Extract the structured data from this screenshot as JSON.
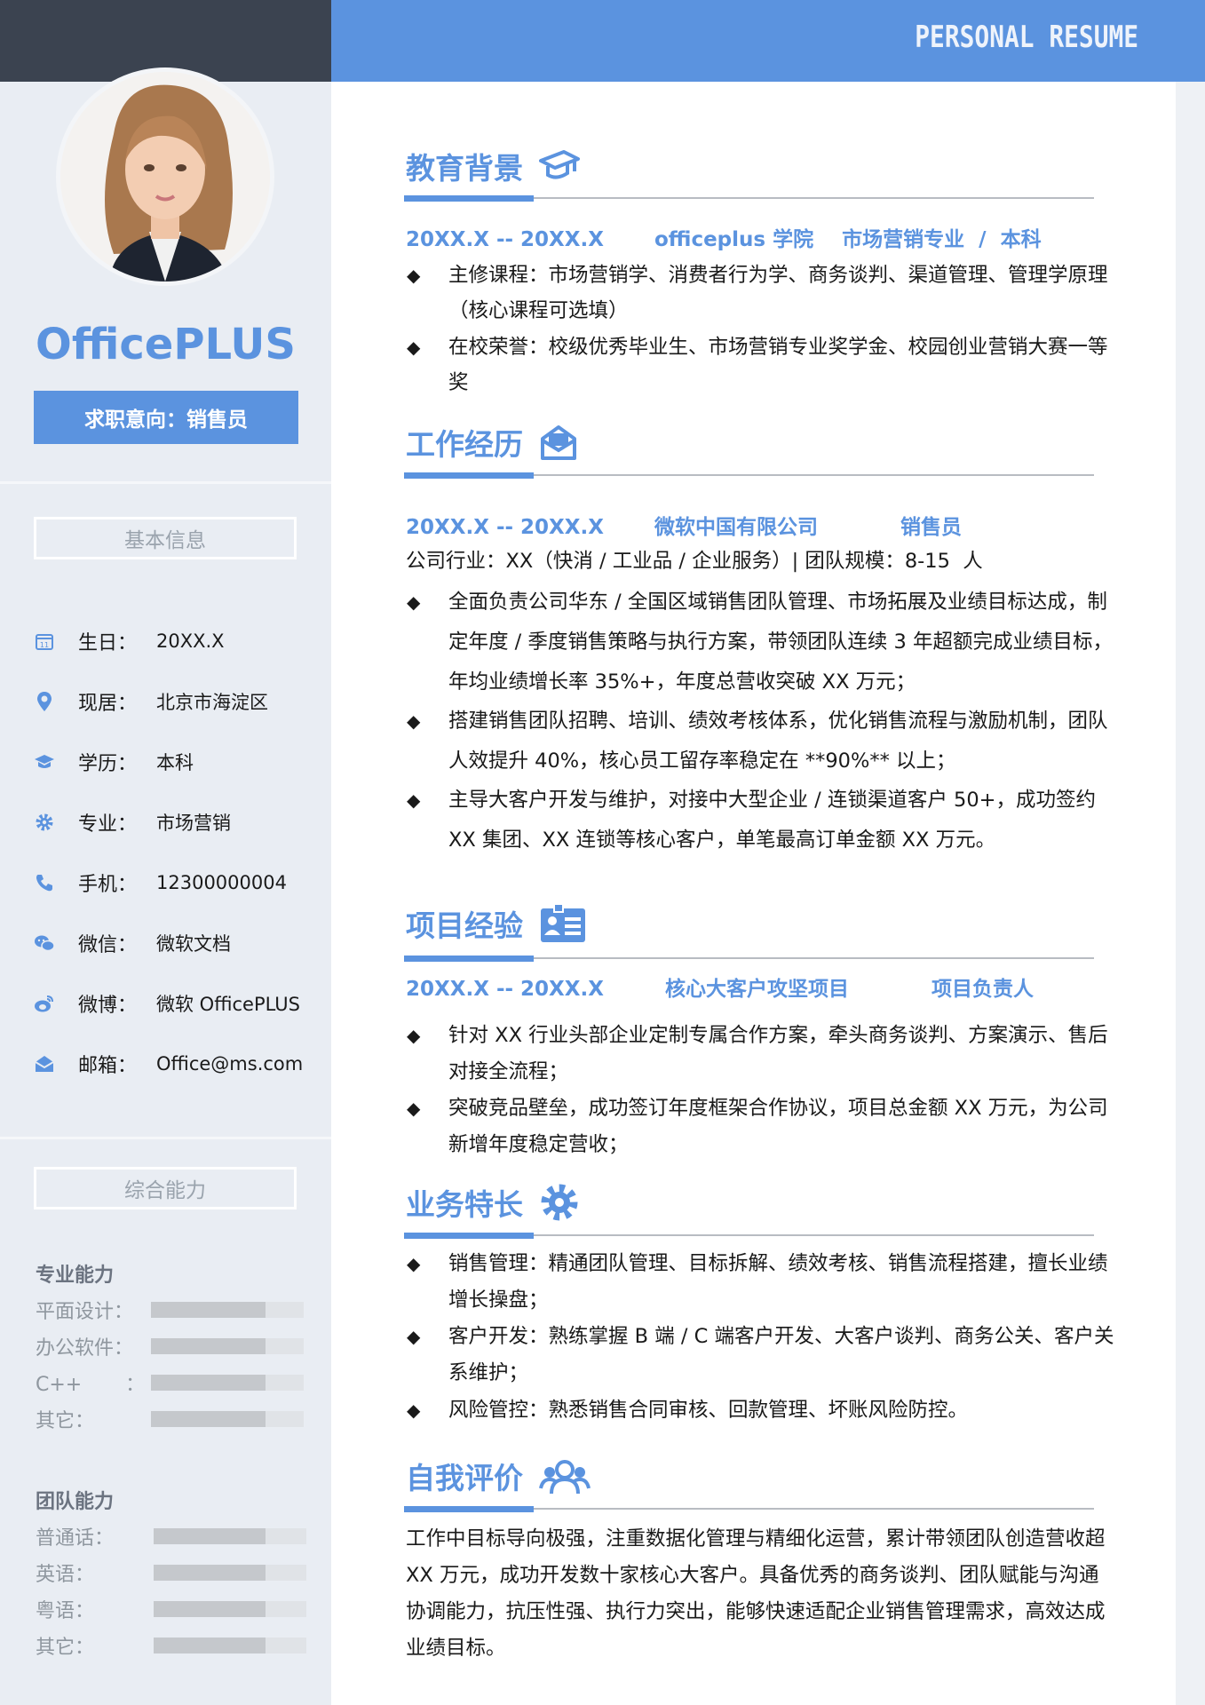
{
  "header": {
    "title": "PERSONAL RESUME"
  },
  "profile": {
    "name": "OfficePLUS",
    "intent": "求职意向：销售员"
  },
  "basic_info": {
    "title": "基本信息",
    "items": [
      {
        "icon": "calendar-icon",
        "label": "生日：",
        "value": "20XX.X"
      },
      {
        "icon": "location-pin-icon",
        "label": "现居：",
        "value": "北京市海淀区"
      },
      {
        "icon": "graduation-cap-icon",
        "label": "学历：",
        "value": "本科"
      },
      {
        "icon": "gear-icon",
        "label": "专业：",
        "value": "市场营销"
      },
      {
        "icon": "phone-icon",
        "label": "手机：",
        "value": "12300000004"
      },
      {
        "icon": "wechat-icon",
        "label": "微信：",
        "value": "微软文档"
      },
      {
        "icon": "weibo-icon",
        "label": "微博：",
        "value": "微软 OfficePLUS"
      },
      {
        "icon": "mail-icon",
        "label": "邮箱：",
        "value": "Office@ms.com"
      }
    ]
  },
  "abilities": {
    "title": "综合能力",
    "groups": [
      {
        "name": "专业能力",
        "items": [
          {
            "label": "平面设计：",
            "level": 0.75
          },
          {
            "label": "办公软件：",
            "level": 0.75
          },
          {
            "label": "C++       ：",
            "level": 0.75
          },
          {
            "label": "其它：",
            "level": 0.75
          }
        ]
      },
      {
        "name": "团队能力",
        "items": [
          {
            "label": "普通话：",
            "level": 0.73
          },
          {
            "label": "英语：",
            "level": 0.73
          },
          {
            "label": "粤语：",
            "level": 0.73
          },
          {
            "label": "其它：",
            "level": 0.73
          }
        ]
      }
    ]
  },
  "education": {
    "title": "教育背景",
    "period": "20XX.X -- 20XX.X",
    "school": "officeplus 学院    市场营销专业  /  本科",
    "bullets": [
      "主修课程：市场营销学、消费者行为学、商务谈判、渠道管理、管理学原理（核心课程可选填）",
      "在校荣誉：校级优秀毕业生、市场营销专业奖学金、校园创业营销大赛一等奖"
    ]
  },
  "work": {
    "title": "工作经历",
    "period": "20XX.X -- 20XX.X",
    "company": "微软中国有限公司",
    "position": "销售员",
    "summary": "公司行业：XX（快消 / 工业品 / 企业服务）| 团队规模：8-15  人",
    "bullets": [
      "全面负责公司华东 / 全国区域销售团队管理、市场拓展及业绩目标达成，制定年度 / 季度销售策略与执行方案，带领团队连续  3  年超额完成业绩目标，年均业绩增长率 35%+，年度总营收突破 XX 万元；",
      "搭建销售团队招聘、培训、绩效考核体系，优化销售流程与激励机制，团队人效提升 40%，核心员工留存率稳定在 **90%** 以上；",
      "主导大客户开发与维护，对接中大型企业 / 连锁渠道客户 50+，成功签约 XX 集团、XX 连锁等核心客户，单笔最高订单金额 XX 万元。"
    ]
  },
  "project": {
    "title": "项目经验",
    "period": "20XX.X -- 20XX.X",
    "name": "核心大客户攻坚项目",
    "role": "项目负责人",
    "bullets": [
      "针对 XX 行业头部企业定制专属合作方案，牵头商务谈判、方案演示、售后对接全流程；",
      "突破竞品壁垒，成功签订年度框架合作协议，项目总金额 XX 万元，为公司新增年度稳定营收；"
    ]
  },
  "skills": {
    "title": "业务特长",
    "bullets": [
      "销售管理：精通团队管理、目标拆解、绩效考核、销售流程搭建，擅长业绩增长操盘；",
      "客户开发：熟练掌握 B 端 / C 端客户开发、大客户谈判、商务公关、客户关系维护；",
      "风险管控：熟悉销售合同审核、回款管理、坏账风险防控。"
    ]
  },
  "self_eval": {
    "title": "自我评价",
    "text": "工作中目标导向极强，注重数据化管理与精细化运营，累计带领团队创造营收超 XX 万元，成功开发数十家核心大客户。具备优秀的商务谈判、团队赋能与沟通协调能力，抗压性强、执行力突出，能够快速适配企业销售管理需求，高效达成业绩目标。"
  },
  "colors": {
    "accent": "#5b93df",
    "dark": "#3b4350",
    "sidebar": "#e9edf3"
  }
}
